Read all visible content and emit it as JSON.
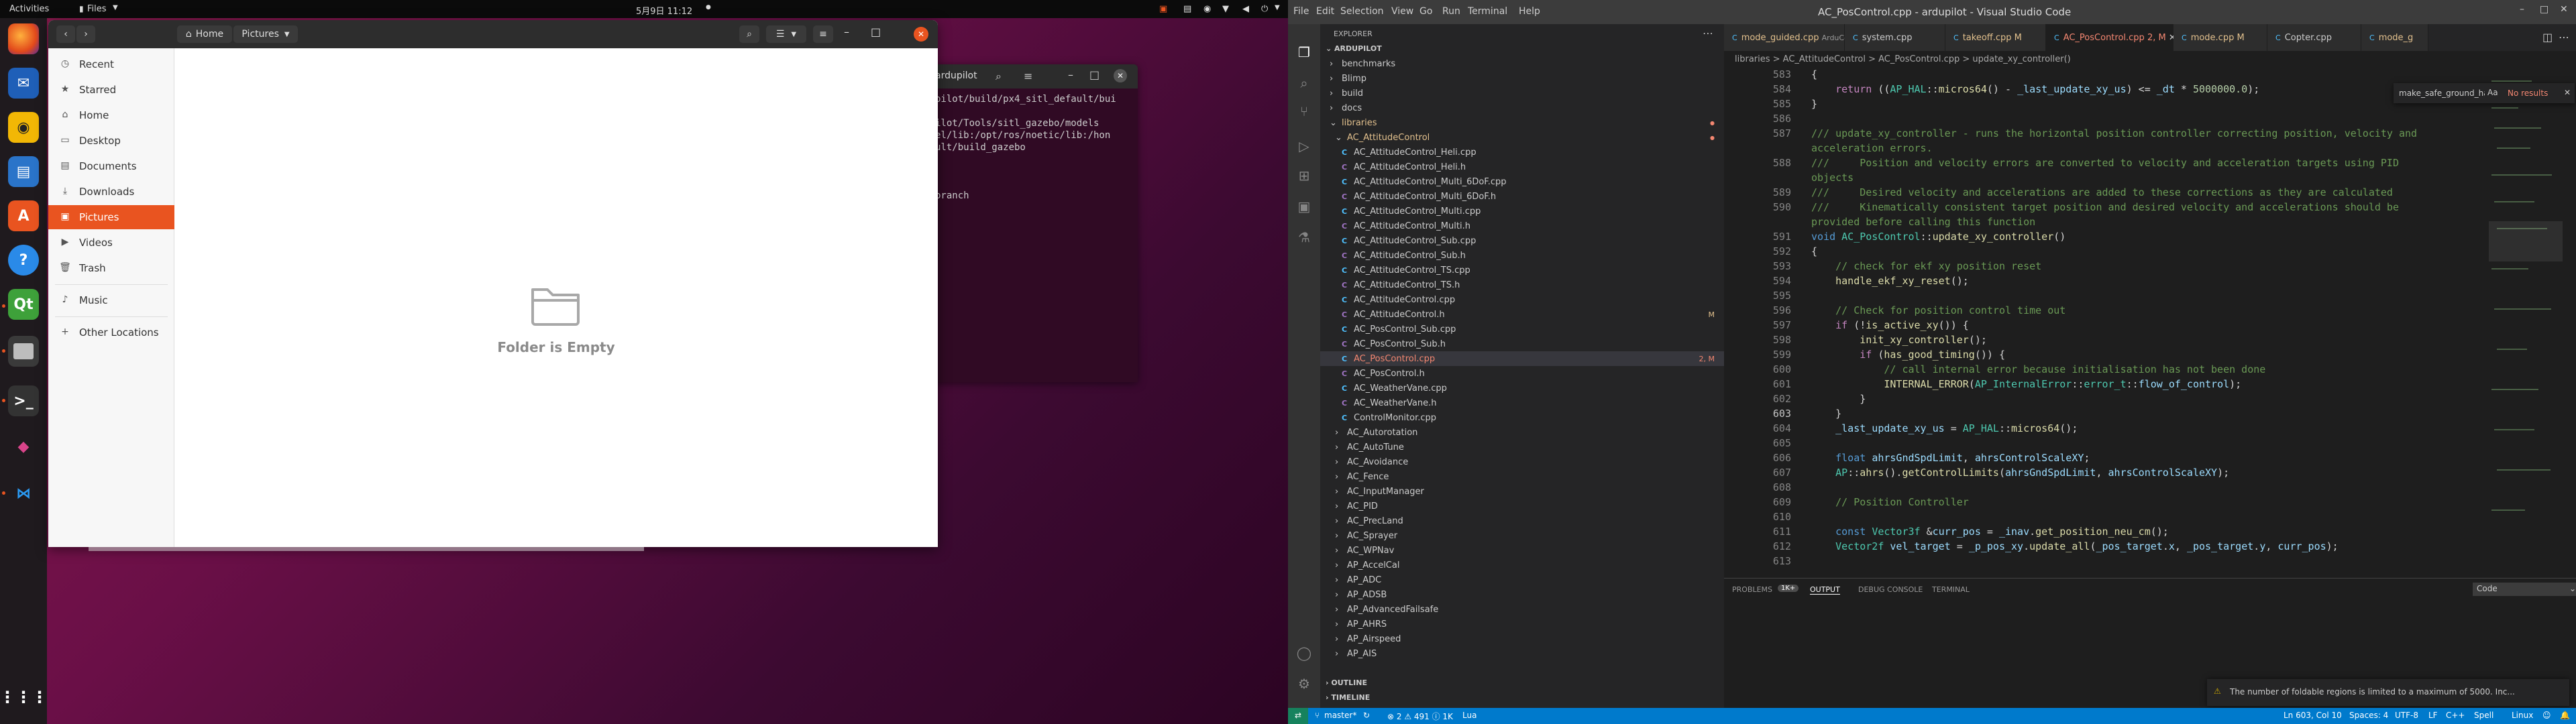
{
  "topbar": {
    "activities": "Activities",
    "app_menu": "Files",
    "clock": "5月9日 11:12"
  },
  "dock": {
    "items": [
      "firefox-icon",
      "thunderbird-icon",
      "rhythmbox-icon",
      "writer-icon",
      "software-icon",
      "help-icon",
      "qtcreator-icon",
      "files-icon",
      "terminal-icon",
      "meshlab-icon",
      "vscode-icon",
      "apps-grid-icon"
    ]
  },
  "terminal": {
    "title": "ardupilot",
    "lines": [
      "pilot/build/px4_sitl_default/bui",
      "",
      "ilot/Tools/sitl_gazebo/models",
      "el/lib:/opt/ros/noetic/lib:/hon",
      "ult/build_gazebo",
      "",
      "",
      "",
      "branch"
    ]
  },
  "files": {
    "location": {
      "home": "Home",
      "current": "Pictures"
    },
    "sidebar": [
      {
        "label": "Recent",
        "icon": "clock-icon"
      },
      {
        "label": "Starred",
        "icon": "star-icon"
      },
      {
        "label": "Home",
        "icon": "home-icon"
      },
      {
        "label": "Desktop",
        "icon": "desktop-folder-icon"
      },
      {
        "label": "Documents",
        "icon": "documents-folder-icon"
      },
      {
        "label": "Downloads",
        "icon": "downloads-folder-icon"
      },
      {
        "label": "Pictures",
        "icon": "pictures-folder-icon"
      },
      {
        "label": "Videos",
        "icon": "videos-folder-icon"
      },
      {
        "label": "Trash",
        "icon": "trash-icon"
      },
      {
        "label": "Music",
        "icon": "music-folder-icon"
      },
      {
        "label": "Other Locations",
        "icon": "plus-icon"
      }
    ],
    "empty_text": "Folder is Empty"
  },
  "vscode": {
    "title": "AC_PosControl.cpp - ardupilot - Visual Studio Code",
    "menu": [
      "File",
      "Edit",
      "Selection",
      "View",
      "Go",
      "Run",
      "Terminal",
      "Help"
    ],
    "explorer_title": "EXPLORER",
    "root": "ARDUPILOT",
    "tree_top": [
      {
        "label": "benchmarks",
        "kind": "folder"
      },
      {
        "label": "Blimp",
        "kind": "folder"
      },
      {
        "label": "build",
        "kind": "folder"
      },
      {
        "label": "docs",
        "kind": "folder"
      },
      {
        "label": "libraries",
        "kind": "folder-open",
        "mod": true
      },
      {
        "label": "AC_AttitudeControl",
        "kind": "folder-open",
        "mod": true
      }
    ],
    "tree_files": [
      {
        "label": "AC_AttitudeControl_Heli.cpp",
        "t": "c"
      },
      {
        "label": "AC_AttitudeControl_Heli.h",
        "t": "h"
      },
      {
        "label": "AC_AttitudeControl_Multi_6DoF.cpp",
        "t": "c"
      },
      {
        "label": "AC_AttitudeControl_Multi_6DoF.h",
        "t": "h"
      },
      {
        "label": "AC_AttitudeControl_Multi.cpp",
        "t": "c"
      },
      {
        "label": "AC_AttitudeControl_Multi.h",
        "t": "h"
      },
      {
        "label": "AC_AttitudeControl_Sub.cpp",
        "t": "c"
      },
      {
        "label": "AC_AttitudeControl_Sub.h",
        "t": "h"
      },
      {
        "label": "AC_AttitudeControl_TS.cpp",
        "t": "c"
      },
      {
        "label": "AC_AttitudeControl_TS.h",
        "t": "h"
      },
      {
        "label": "AC_AttitudeControl.cpp",
        "t": "c"
      },
      {
        "label": "AC_AttitudeControl.h",
        "t": "h",
        "badge": "M"
      },
      {
        "label": "AC_PosControl_Sub.cpp",
        "t": "c"
      },
      {
        "label": "AC_PosControl_Sub.h",
        "t": "h"
      },
      {
        "label": "AC_PosControl.cpp",
        "t": "c",
        "badge": "2, M",
        "sel": true
      },
      {
        "label": "AC_PosControl.h",
        "t": "h"
      },
      {
        "label": "AC_WeatherVane.cpp",
        "t": "c"
      },
      {
        "label": "AC_WeatherVane.h",
        "t": "h"
      },
      {
        "label": "ControlMonitor.cpp",
        "t": "c"
      }
    ],
    "tree_folders": [
      "AC_Autorotation",
      "AC_AutoTune",
      "AC_Avoidance",
      "AC_Fence",
      "AC_InputManager",
      "AC_PID",
      "AC_PrecLand",
      "AC_Sprayer",
      "AC_WPNav",
      "AP_AccelCal",
      "AP_ADC",
      "AP_ADSB",
      "AP_AdvancedFailsafe",
      "AP_AHRS",
      "AP_Airspeed",
      "AP_AIS"
    ],
    "outline": "OUTLINE",
    "timeline": "TIMELINE",
    "tabs": [
      {
        "label": "mode_guided.cpp",
        "extra": "ArduCopter  M"
      },
      {
        "label": "system.cpp",
        "extra": ""
      },
      {
        "label": "takeoff.cpp",
        "extra": "M"
      },
      {
        "label": "AC_PosControl.cpp",
        "extra": "2, M"
      },
      {
        "label": "mode.cpp",
        "extra": "M"
      },
      {
        "label": "Copter.cpp",
        "extra": ""
      },
      {
        "label": "mode_g",
        "extra": ""
      }
    ],
    "breadcrumb": "libraries > AC_AttitudeControl > AC_PosControl.cpp > update_xy_controller()",
    "find": {
      "query": "make_safe_ground_handl",
      "result": "No results"
    },
    "panel_tabs": [
      "PROBLEMS",
      "OUTPUT",
      "DEBUG CONSOLE",
      "TERMINAL"
    ],
    "problems_count": "1K+",
    "output_channel": "Code",
    "notification": "The number of foldable regions is limited to a maximum of 5000. Inc...",
    "status": {
      "branch": "master*",
      "problems": "⊗ 2  ⚠ 491  ⓘ 1K",
      "lua": "Lua",
      "position": "Ln 603, Col 10",
      "spaces": "Spaces: 4",
      "encoding": "UTF-8",
      "eol": "LF",
      "language": "C++",
      "spell": "Spell",
      "platform": "Linux"
    }
  }
}
